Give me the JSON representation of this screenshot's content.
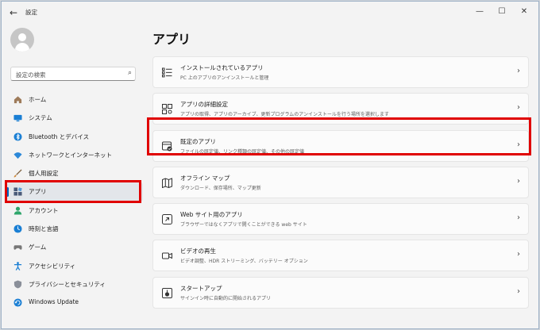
{
  "window": {
    "title": "設定",
    "back_glyph": "←",
    "minimize_glyph": "—",
    "maximize_glyph": "☐",
    "close_glyph": "✕"
  },
  "search": {
    "placeholder": "設定の検索",
    "icon_glyph": "⌕"
  },
  "sidebar": {
    "items": [
      {
        "label": "ホーム",
        "icon": "home-icon",
        "color": "#9e7b5a"
      },
      {
        "label": "システム",
        "icon": "system-icon",
        "color": "#1a7fd4"
      },
      {
        "label": "Bluetooth とデバイス",
        "icon": "bluetooth-icon",
        "color": "#1a7fd4"
      },
      {
        "label": "ネットワークとインターネット",
        "icon": "network-icon",
        "color": "#2b88d8"
      },
      {
        "label": "個人用設定",
        "icon": "brush-icon",
        "color": "#d08a3a"
      },
      {
        "label": "アプリ",
        "icon": "apps-icon",
        "color": "#4a5a78",
        "active": true
      },
      {
        "label": "アカウント",
        "icon": "account-icon",
        "color": "#2ea66b"
      },
      {
        "label": "時刻と言語",
        "icon": "time-language-icon",
        "color": "#1a7fd4"
      },
      {
        "label": "ゲーム",
        "icon": "gaming-icon",
        "color": "#777777"
      },
      {
        "label": "アクセシビリティ",
        "icon": "accessibility-icon",
        "color": "#1a7fd4"
      },
      {
        "label": "プライバシーとセキュリティ",
        "icon": "shield-icon",
        "color": "#8a8f99"
      },
      {
        "label": "Windows Update",
        "icon": "windows-update-icon",
        "color": "#1a7fd4"
      }
    ]
  },
  "main": {
    "title": "アプリ",
    "cards": [
      {
        "title": "インストールされているアプリ",
        "desc": "PC 上のアプリのアンインストールと管理",
        "icon": "installed-apps-icon"
      },
      {
        "title": "アプリの詳細設定",
        "desc": "アプリの取得、アプリのアーカイブ、更新プログラムのアンインストールを行う場所を選択します",
        "icon": "advanced-settings-icon"
      },
      {
        "title": "既定のアプリ",
        "desc": "ファイルの既定値、リンク種類の既定値、その他の既定値",
        "icon": "default-apps-icon"
      },
      {
        "title": "オフライン マップ",
        "desc": "ダウンロード、保存場所、マップ更新",
        "icon": "offline-maps-icon"
      },
      {
        "title": "Web サイト用のアプリ",
        "desc": "ブラウザーではなくアプリで開くことができる web サイト",
        "icon": "web-apps-icon"
      },
      {
        "title": "ビデオの再生",
        "desc": "ビデオ調整、HDR ストリーミング、バッテリー オプション",
        "icon": "video-icon"
      },
      {
        "title": "スタートアップ",
        "desc": "サインイン時に自動的に開始されるアプリ",
        "icon": "startup-icon"
      }
    ],
    "chevron_glyph": "›"
  },
  "colors": {
    "accent": "#0067c0",
    "highlight_box": "#e00000"
  }
}
